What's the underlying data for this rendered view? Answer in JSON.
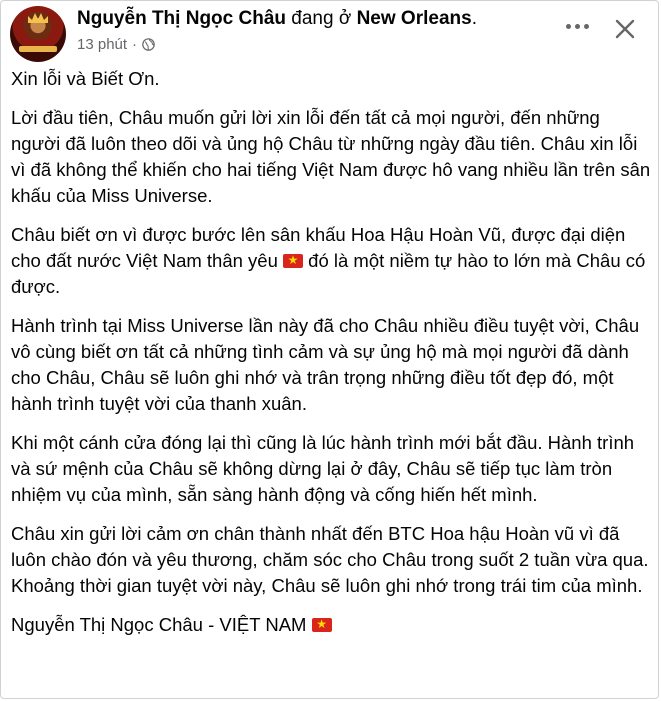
{
  "post": {
    "author": "Nguyễn Thị Ngọc Châu",
    "location_prefix": "đang ở",
    "location": "New Orleans",
    "location_suffix": ".",
    "time": "13 phút",
    "separator": "·",
    "privacy_icon": "globe-icon",
    "paragraphs": [
      "Xin lỗi và Biết Ơn.",
      "Lời đầu tiên, Châu muốn gửi lời xin lỗi đến tất cả mọi người, đến những người đã luôn theo dõi và ủng hộ Châu từ những ngày đầu tiên. Châu xin lỗi vì đã không thể khiến cho hai tiếng Việt Nam được hô vang nhiều lần trên sân khấu của Miss Universe.",
      "Châu biết ơn vì được bước lên sân khấu Hoa Hậu Hoàn Vũ, được đại diện cho đất nước Việt Nam thân yêu",
      "đó là một niềm tự hào to lớn mà Châu có được.",
      "Hành trình tại Miss Universe lần này đã cho Châu nhiều điều tuyệt vời, Châu vô cùng biết ơn tất cả những tình cảm và sự ủng hộ mà mọi người đã dành cho Châu, Châu sẽ luôn ghi nhớ và trân trọng những điều tốt đẹp đó, một hành trình tuyệt vời của thanh xuân.",
      "Khi một cánh cửa đóng lại thì cũng là lúc hành trình mới bắt đầu. Hành trình và sứ mệnh của Châu sẽ không dừng lại ở đây, Châu sẽ tiếp tục làm tròn nhiệm vụ của mình, sẵn sàng hành động và cống hiến hết mình.",
      "Châu xin gửi lời cảm ơn chân thành nhất đến BTC Hoa hậu Hoàn vũ vì đã luôn chào đón và yêu thương, chăm sóc cho Châu trong suốt 2 tuần vừa qua. Khoảng thời gian tuyệt vời này, Châu sẽ luôn ghi nhớ trong trái tim của mình.",
      "Nguyễn Thị Ngọc Châu - VIỆT NAM"
    ]
  },
  "icons": {
    "more": "more-options-icon",
    "close": "close-icon",
    "flag": "vietnam-flag-icon"
  },
  "colors": {
    "text": "#050505",
    "meta": "#65676b",
    "flag_red": "#da251d",
    "flag_star": "#ffde00"
  }
}
